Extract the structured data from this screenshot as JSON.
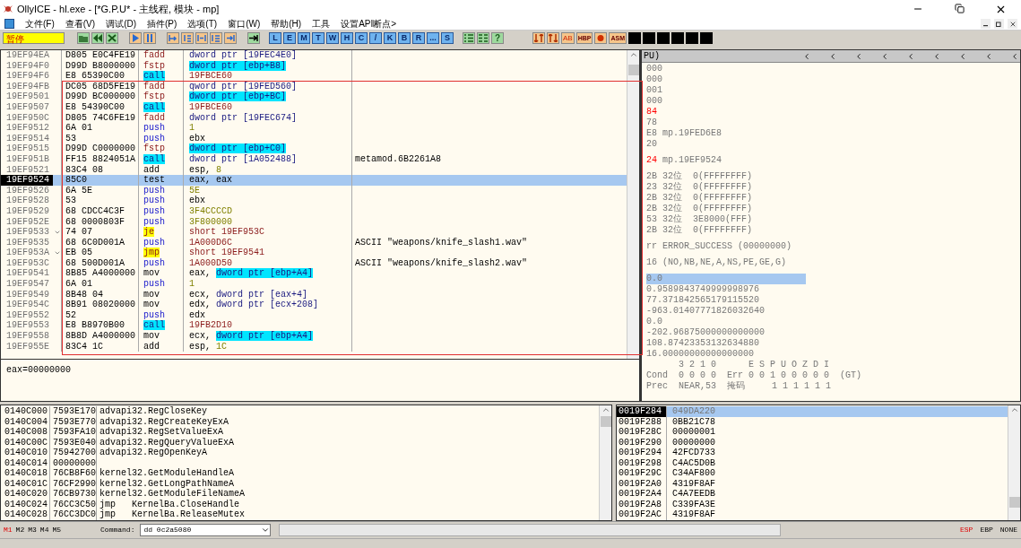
{
  "window": {
    "title": "OllyICE - hl.exe - [*G.P.U* - 主线程, 模块 - mp]"
  },
  "menu": [
    "文件(F)",
    "查看(V)",
    "调试(D)",
    "插件(P)",
    "选项(T)",
    "窗口(W)",
    "帮助(H)",
    "工具",
    "设置API断点>"
  ],
  "toolbar": {
    "status": "暂停",
    "letter_buttons": [
      "L",
      "E",
      "M",
      "T",
      "W",
      "H",
      "C",
      "/",
      "K",
      "B",
      "R",
      "...",
      "S"
    ],
    "help_button": "?",
    "plugin_labels": [
      "AB",
      "HBP",
      "ASM"
    ]
  },
  "disassembly": [
    {
      "address": "19EF94EA",
      "hex": "D805 E0C4FE19",
      "mnemonic": "fadd",
      "kind": "fpu",
      "operand": [
        {
          "text": "dword ptr [19FEC4E0]",
          "kind": "mem"
        }
      ],
      "selected": false
    },
    {
      "address": "19EF94F0",
      "hex": "D99D B8000000",
      "mnemonic": "fstp",
      "kind": "fpu",
      "operand": [
        {
          "text": "dword ptr [ebp+B8]",
          "kind": "stack"
        }
      ],
      "selected": false
    },
    {
      "address": "19EF94F6",
      "hex": "E8 65390C00",
      "mnemonic": "call",
      "kind": "call",
      "operand": [
        {
          "text": "19FBCE60",
          "kind": "addr"
        }
      ],
      "selected": false
    },
    {
      "address": "19EF94FB",
      "hex": "DC05 68D5FE19",
      "mnemonic": "fadd",
      "kind": "fpu",
      "operand": [
        {
          "text": "qword ptr [19FED560]",
          "kind": "mem"
        }
      ],
      "selected": false
    },
    {
      "address": "19EF9501",
      "hex": "D99D BC000000",
      "mnemonic": "fstp",
      "kind": "fpu",
      "operand": [
        {
          "text": "dword ptr [ebp+BC]",
          "kind": "stack"
        }
      ],
      "selected": false
    },
    {
      "address": "19EF9507",
      "hex": "E8 54390C00",
      "mnemonic": "call",
      "kind": "call",
      "operand": [
        {
          "text": "19FBCE60",
          "kind": "addr"
        }
      ],
      "selected": false
    },
    {
      "address": "19EF950C",
      "hex": "D805 74C6FE19",
      "mnemonic": "fadd",
      "kind": "fpu",
      "operand": [
        {
          "text": "dword ptr [19FEC674]",
          "kind": "mem"
        }
      ],
      "selected": false
    },
    {
      "address": "19EF9512",
      "hex": "6A 01",
      "mnemonic": "push",
      "kind": "push",
      "operand": [
        {
          "text": "1",
          "kind": "imm"
        }
      ],
      "selected": false
    },
    {
      "address": "19EF9514",
      "hex": "53",
      "mnemonic": "push",
      "kind": "push",
      "operand": [
        {
          "text": "ebx",
          "kind": "reg"
        }
      ],
      "selected": false
    },
    {
      "address": "19EF9515",
      "hex": "D99D C0000000",
      "mnemonic": "fstp",
      "kind": "fpu",
      "operand": [
        {
          "text": "dword ptr [ebp+C0]",
          "kind": "stack"
        }
      ],
      "selected": false
    },
    {
      "address": "19EF951B",
      "hex": "FF15 8824051A",
      "mnemonic": "call",
      "kind": "call",
      "operand": [
        {
          "text": "dword ptr [1A052488]",
          "kind": "mem"
        }
      ],
      "comment": "metamod.6B2261A8",
      "selected": false
    },
    {
      "address": "19EF9521",
      "hex": "83C4 08",
      "mnemonic": "add",
      "kind": "plain",
      "operand": [
        {
          "text": "esp, ",
          "kind": "reg"
        },
        {
          "text": "8",
          "kind": "imm"
        }
      ],
      "selected": false
    },
    {
      "address": "19EF9524",
      "hex": "85C0",
      "mnemonic": "test",
      "kind": "plain",
      "operand": [
        {
          "text": "eax, eax",
          "kind": "reg"
        }
      ],
      "selected": true
    },
    {
      "address": "19EF9526",
      "hex": "6A 5E",
      "mnemonic": "push",
      "kind": "push",
      "operand": [
        {
          "text": "5E",
          "kind": "imm"
        }
      ],
      "selected": false
    },
    {
      "address": "19EF9528",
      "hex": "53",
      "mnemonic": "push",
      "kind": "push",
      "operand": [
        {
          "text": "ebx",
          "kind": "reg"
        }
      ],
      "selected": false
    },
    {
      "address": "19EF9529",
      "hex": "68 CDCC4C3F",
      "mnemonic": "push",
      "kind": "push",
      "operand": [
        {
          "text": "3F4CCCCD",
          "kind": "imm"
        }
      ],
      "selected": false
    },
    {
      "address": "19EF952E",
      "hex": "68 0000803F",
      "mnemonic": "push",
      "kind": "push",
      "operand": [
        {
          "text": "3F800000",
          "kind": "imm"
        }
      ],
      "selected": false
    },
    {
      "address": "19EF9533",
      "hex": "74 07",
      "mnemonic": "je",
      "kind": "jump",
      "operand": [
        {
          "text": "short 19EF953C",
          "kind": "addr"
        }
      ],
      "jump_mark": true,
      "selected": false
    },
    {
      "address": "19EF9535",
      "hex": "68 6C0D001A",
      "mnemonic": "push",
      "kind": "push",
      "operand": [
        {
          "text": "1A000D6C",
          "kind": "addr"
        }
      ],
      "comment": "ASCII \"weapons/knife_slash1.wav\"",
      "selected": false
    },
    {
      "address": "19EF953A",
      "hex": "EB 05",
      "mnemonic": "jmp",
      "kind": "jump",
      "operand": [
        {
          "text": "short 19EF9541",
          "kind": "addr"
        }
      ],
      "jump_mark": true,
      "selected": false
    },
    {
      "address": "19EF953C",
      "hex": "68 500D001A",
      "mnemonic": "push",
      "kind": "push",
      "operand": [
        {
          "text": "1A000D50",
          "kind": "addr"
        }
      ],
      "comment": "ASCII \"weapons/knife_slash2.wav\"",
      "selected": false
    },
    {
      "address": "19EF9541",
      "hex": "8B85 A4000000",
      "mnemonic": "mov",
      "kind": "plain",
      "operand": [
        {
          "text": "eax, ",
          "kind": "reg"
        },
        {
          "text": "dword ptr [ebp+A4]",
          "kind": "stack"
        }
      ],
      "selected": false
    },
    {
      "address": "19EF9547",
      "hex": "6A 01",
      "mnemonic": "push",
      "kind": "push",
      "operand": [
        {
          "text": "1",
          "kind": "imm"
        }
      ],
      "selected": false
    },
    {
      "address": "19EF9549",
      "hex": "8B48 04",
      "mnemonic": "mov",
      "kind": "plain",
      "operand": [
        {
          "text": "ecx, ",
          "kind": "reg"
        },
        {
          "text": "dword ptr [eax+4]",
          "kind": "mem"
        }
      ],
      "selected": false
    },
    {
      "address": "19EF954C",
      "hex": "8B91 08020000",
      "mnemonic": "mov",
      "kind": "plain",
      "operand": [
        {
          "text": "edx, ",
          "kind": "reg"
        },
        {
          "text": "dword ptr [ecx+208]",
          "kind": "mem"
        }
      ],
      "selected": false
    },
    {
      "address": "19EF9552",
      "hex": "52",
      "mnemonic": "push",
      "kind": "push",
      "operand": [
        {
          "text": "edx",
          "kind": "reg"
        }
      ],
      "selected": false
    },
    {
      "address": "19EF9553",
      "hex": "E8 B8970B00",
      "mnemonic": "call",
      "kind": "call",
      "operand": [
        {
          "text": "19FB2D10",
          "kind": "addr"
        }
      ],
      "selected": false
    },
    {
      "address": "19EF9558",
      "hex": "8B8D A4000000",
      "mnemonic": "mov",
      "kind": "plain",
      "operand": [
        {
          "text": "ecx, ",
          "kind": "reg"
        },
        {
          "text": "dword ptr [ebp+A4]",
          "kind": "stack"
        }
      ],
      "selected": false
    },
    {
      "address": "19EF955E",
      "hex": "83C4 1C",
      "mnemonic": "add",
      "kind": "plain",
      "operand": [
        {
          "text": "esp, ",
          "kind": "reg"
        },
        {
          "text": "1C",
          "kind": "imm"
        }
      ],
      "selected": false
    }
  ],
  "info_line": "eax=00000000",
  "registers": {
    "header": "PU)",
    "groups": [
      [
        {
          "value": "000",
          "changed": false
        },
        {
          "value": "000",
          "changed": false
        },
        {
          "value": "001",
          "changed": false
        },
        {
          "value": "000",
          "changed": false
        },
        {
          "value": "84",
          "changed": true
        },
        {
          "value": "78",
          "changed": false
        },
        {
          "value": "E8",
          "note": "mp.19FED6E8",
          "changed": false
        },
        {
          "value": "20",
          "changed": false
        }
      ],
      [
        {
          "value": "24",
          "note": "mp.19EF9524",
          "changed": true
        }
      ],
      [
        {
          "value": "2B",
          "note": "32位  0(FFFFFFFF)",
          "changed": false
        },
        {
          "value": "23",
          "note": "32位  0(FFFFFFFF)",
          "changed": false
        },
        {
          "value": "2B",
          "note": "32位  0(FFFFFFFF)",
          "changed": false
        },
        {
          "value": "2B",
          "note": "32位  0(FFFFFFFF)",
          "changed": false
        },
        {
          "value": "53",
          "note": "32位  3E8000(FFF)",
          "changed": false
        },
        {
          "value": "2B",
          "note": "32位  0(FFFFFFFF)",
          "changed": false
        }
      ],
      [
        {
          "value": "rr",
          "note": "ERROR_SUCCESS (00000000)",
          "changed": false
        }
      ],
      [
        {
          "value": "16",
          "note": "(NO,NB,NE,A,NS,PE,GE,G)",
          "changed": false
        }
      ]
    ],
    "fpu": [
      {
        "value": "0.0",
        "selected": true
      },
      {
        "value": "0.9589843749999998976",
        "selected": false
      },
      {
        "value": "77.371842565179115520",
        "selected": false
      },
      {
        "value": "-963.01407771826032640",
        "selected": false
      },
      {
        "value": "0.0",
        "selected": false
      },
      {
        "value": "-202.96875000000000000",
        "selected": false
      },
      {
        "value": "108.87423353132634880",
        "selected": false
      },
      {
        "value": "16.00000000000000000",
        "selected": false
      }
    ],
    "fpu_flags": [
      "      3 2 1 0      E S P U O Z D I",
      "Cond  0 0 0 0  Err 0 0 1 0 0 0 0 0  (GT)",
      "Prec  NEAR,53  掩码     1 1 1 1 1 1"
    ]
  },
  "dump": [
    {
      "address": "0140C000",
      "value": "7593E170",
      "comment": "advapi32.RegCloseKey"
    },
    {
      "address": "0140C004",
      "value": "7593E770",
      "comment": "advapi32.RegCreateKeyExA"
    },
    {
      "address": "0140C008",
      "value": "7593FA10",
      "comment": "advapi32.RegSetValueExA"
    },
    {
      "address": "0140C00C",
      "value": "7593E040",
      "comment": "advapi32.RegQueryValueExA"
    },
    {
      "address": "0140C010",
      "value": "75942700",
      "comment": "advapi32.RegOpenKeyA"
    },
    {
      "address": "0140C014",
      "value": "00000000"
    },
    {
      "address": "0140C018",
      "value": "76CB8F60",
      "comment": "kernel32.GetModuleHandleA"
    },
    {
      "address": "0140C01C",
      "value": "76CF2990",
      "comment": "kernel32.GetLongPathNameA"
    },
    {
      "address": "0140C020",
      "value": "76CB9730",
      "comment": "kernel32.GetModuleFileNameA"
    },
    {
      "address": "0140C024",
      "value": "76CC3C50",
      "comment": "jmp   KernelBa.CloseHandle"
    },
    {
      "address": "0140C028",
      "value": "76CC3DC0",
      "comment": "jmp   KernelBa.ReleaseMutex"
    }
  ],
  "stack": [
    {
      "address": "0019F284",
      "value": "049DA220",
      "selected": true
    },
    {
      "address": "0019F288",
      "value": "0BB21C78",
      "selected": false
    },
    {
      "address": "0019F28C",
      "value": "00000001",
      "selected": false
    },
    {
      "address": "0019F290",
      "value": "00000000",
      "selected": false
    },
    {
      "address": "0019F294",
      "value": "42FCD733",
      "selected": false
    },
    {
      "address": "0019F298",
      "value": "C4AC5D0B",
      "selected": false
    },
    {
      "address": "0019F29C",
      "value": "C34AF800",
      "selected": false
    },
    {
      "address": "0019F2A0",
      "value": "4319F8AF",
      "selected": false
    },
    {
      "address": "0019F2A4",
      "value": "C4A7EEDB",
      "selected": false
    },
    {
      "address": "0019F2A8",
      "value": "C339FA3E",
      "selected": false
    },
    {
      "address": "0019F2AC",
      "value": "4319F8AF",
      "selected": false
    }
  ],
  "bottom_bar": {
    "memory_tabs": [
      {
        "label": "M1",
        "selected": true
      },
      {
        "label": "M2",
        "selected": false
      },
      {
        "label": "M3",
        "selected": false
      },
      {
        "label": "M4",
        "selected": false
      },
      {
        "label": "M5",
        "selected": false
      }
    ],
    "command_label": "Command:",
    "command_value": "dd 0c2a5080",
    "stack_modes": [
      {
        "label": "ESP",
        "selected": true
      },
      {
        "label": "EBP",
        "selected": false
      },
      {
        "label": "NONE",
        "selected": false
      }
    ]
  }
}
